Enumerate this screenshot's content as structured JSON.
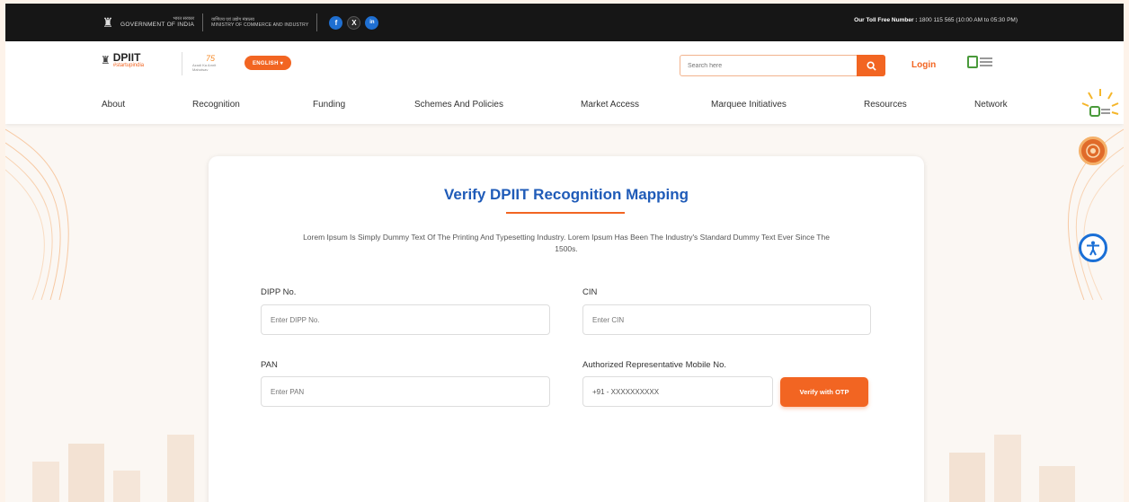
{
  "topbar": {
    "gov_hindi": "भारत सरकार",
    "gov_english": "GOVERNMENT OF INDIA",
    "ministry_hindi": "वाणिज्य एवं उद्योग मंत्रालय",
    "ministry_english": "MINISTRY OF COMMERCE AND INDUSTRY",
    "social": [
      "f",
      "X",
      "in"
    ],
    "tollfree_label": "Our Toll Free Number :",
    "tollfree_value": "1800 115 565 (10:00 AM to 05:30 PM)"
  },
  "header": {
    "logo_main": "DPIIT",
    "logo_sub": "#startupindia",
    "azadi_logo": "75",
    "azadi_sub": "Azadi Ka Amrit Mahotsav",
    "language": "ENGLISH ▾",
    "search_placeholder": "Search here",
    "login": "Login"
  },
  "nav": {
    "items": [
      "About",
      "Recognition",
      "Funding",
      "Schemes And Policies",
      "Market Access",
      "Marquee Initiatives",
      "Resources",
      "Network"
    ]
  },
  "form": {
    "title": "Verify DPIIT Recognition Mapping",
    "description": "Lorem Ipsum Is Simply Dummy Text Of The Printing And Typesetting Industry. Lorem Ipsum Has Been The Industry's Standard Dummy Text Ever Since The 1500s.",
    "dipp_label": "DIPP No.",
    "dipp_placeholder": "Enter DIPP No.",
    "cin_label": "CIN",
    "cin_placeholder": "Enter CIN",
    "pan_label": "PAN",
    "pan_placeholder": "Enter PAN",
    "mobile_label": "Authorized Representative Mobile No.",
    "mobile_value": "+91 - XXXXXXXXXX",
    "otp_button": "Verify with OTP"
  },
  "colors": {
    "accent": "#f26522",
    "title_blue": "#1f5bb8",
    "topbar": "#161616"
  }
}
